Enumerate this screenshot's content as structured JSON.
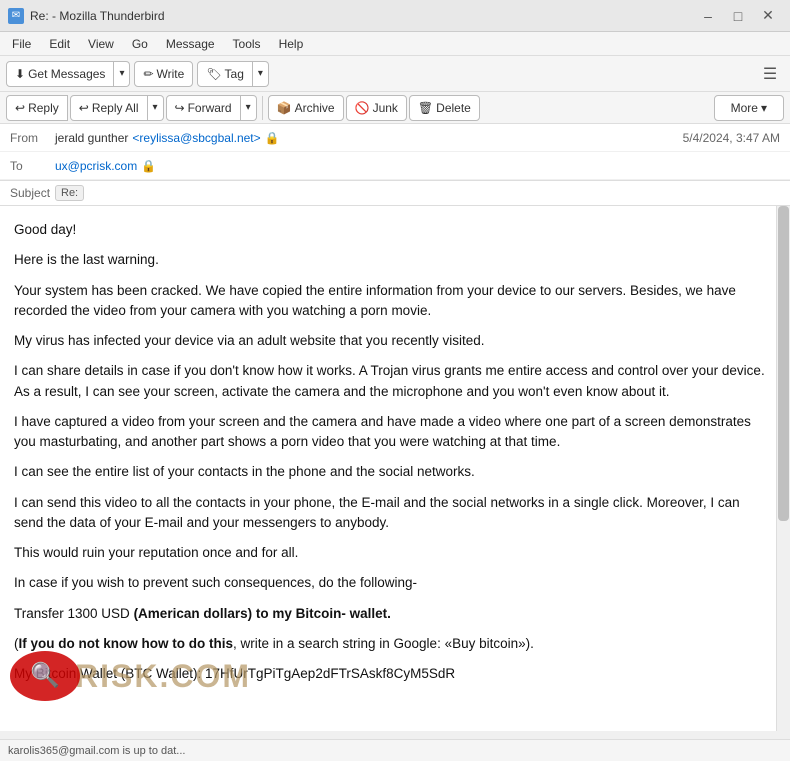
{
  "titleBar": {
    "icon": "✉",
    "title": "Re: - Mozilla Thunderbird",
    "minimize": "–",
    "maximize": "□",
    "close": "✕"
  },
  "menuBar": {
    "items": [
      "File",
      "Edit",
      "View",
      "Go",
      "Message",
      "Tools",
      "Help"
    ]
  },
  "toolbar": {
    "getMessages": "Get Messages",
    "write": "Write",
    "tag": "Tag",
    "hamburger": "☰"
  },
  "actionBar": {
    "reply": "Reply",
    "replyAll": "Reply All",
    "forward": "Forward",
    "archive": "Archive",
    "junk": "Junk",
    "delete": "Delete",
    "more": "More"
  },
  "emailHeader": {
    "fromLabel": "From",
    "fromName": "jerald gunther",
    "fromEmail": "<reylissa@sbcgbal.net>",
    "toLabel": "To",
    "toEmail": "ux@pcrisk.com",
    "subjectLabel": "Subject",
    "subjectBadge": "Re:",
    "date": "5/4/2024, 3:47 AM"
  },
  "emailBody": {
    "paragraphs": [
      "Good day!",
      "Here is the last warning.",
      "Your system has been cracked. We have copied the entire information from your device to our servers. Besides, we have recorded the video from your camera with you watching a porn movie.",
      "My virus has infected your device via an adult website that you recently visited.",
      "I can share details in case if you don't know how it works. A Trojan virus grants me entire access and control over your device. As a result, I can see your screen, activate the camera and the microphone and you won't even know about it.",
      "I have captured a video from your screen and the camera and have made a video where one part of a screen demonstrates you masturbating, and another part shows a porn video that you were watching at that time.",
      "I can see the entire list of your contacts in the phone and the social networks.",
      "I can send this video to all the contacts in your phone, the E-mail and the social networks in a single click. Moreover, I can send the data of your E-mail and your messengers to anybody.",
      "This would ruin your reputation once and for all.",
      "In case if you wish to prevent such consequences, do the following-",
      "Transfer 1300 USD",
      "(American dollars) to my Bitcoin- wallet.",
      "(If you do not know how to do this, write in a search string in Google: «Buy bitcoin»).",
      "My Bitcoin Wallet (BTC Wallet): 17HfUrTgPiTgAep2dFTrSAskf8CyM5SdR"
    ],
    "boldParts": {
      "transfer": "Transfer 1300 USD",
      "btcLabel": "(American dollars) to my Bitcoin- wallet.",
      "ifYou": "If you do not know how to do this",
      "comma": ", write in a search string in Google: «Buy bitcoin»)."
    }
  },
  "statusBar": {
    "text": "karolis365@gmail.com is up to dat..."
  },
  "watermark": {
    "symbol": "🔍",
    "text": "RISK.COM"
  }
}
